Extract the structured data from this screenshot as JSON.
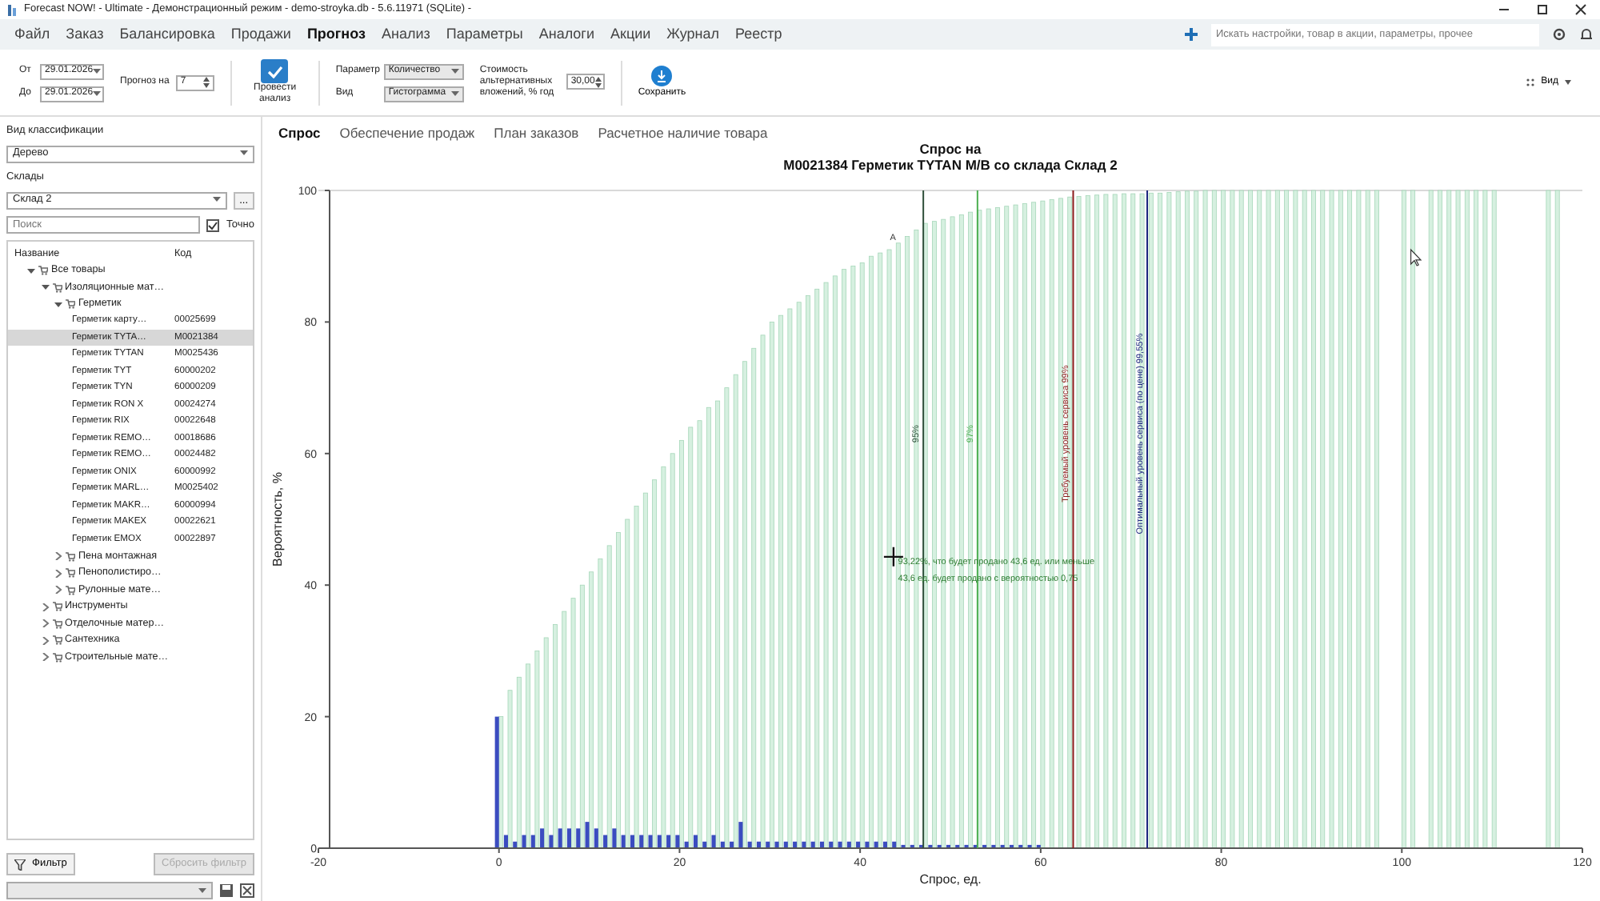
{
  "window": {
    "title": "Forecast NOW! - Ultimate - Демонстрационный режим - demo-stroyka.db - 5.6.11971 (SQLite) -"
  },
  "menu": [
    {
      "label": "Файл",
      "selected": false
    },
    {
      "label": "Заказ",
      "selected": false
    },
    {
      "label": "Балансировка",
      "selected": false
    },
    {
      "label": "Продажи",
      "selected": false
    },
    {
      "label": "Прогноз",
      "selected": true
    },
    {
      "label": "Анализ",
      "selected": false
    },
    {
      "label": "Параметры",
      "selected": false
    },
    {
      "label": "Аналоги",
      "selected": false
    },
    {
      "label": "Акции",
      "selected": false
    },
    {
      "label": "Журнал",
      "selected": false
    },
    {
      "label": "Реестр",
      "selected": false
    }
  ],
  "global_search": {
    "placeholder": "Искать настройки, товар в акции, параметры, прочее"
  },
  "toolbar": {
    "from_label": "От",
    "from_value": "29.01.2026",
    "to_label": "До",
    "to_value": "29.01.2026",
    "forecast_label": "Прогноз на",
    "forecast_value": "7",
    "analyze": {
      "label": "Провести анализ",
      "checked": true
    },
    "param_label": "Параметр",
    "param_value": "Количество",
    "view_label": "Вид",
    "view_value": "Гистограмма",
    "rate_label": "Стоимость альтернативных вложений, % год",
    "rate_value": "30,00",
    "save_label": "Сохранить",
    "view_menu": "Вид"
  },
  "sidebar": {
    "classification_label": "Вид классификации",
    "classification_value": "Дерево",
    "warehouses_label": "Склады",
    "warehouse_value": "Склад 2",
    "browse_button": "...",
    "search": {
      "placeholder": "Поиск"
    },
    "exact": {
      "label": "Точно",
      "checked": true
    },
    "columns": [
      "Название",
      "Код"
    ],
    "tree": [
      {
        "name": "Все товары",
        "expanded": true,
        "selected": false,
        "children": [
          {
            "name": "Изоляционные мат…",
            "expanded": true,
            "selected": false,
            "children": [
              {
                "name": "Герметик",
                "expanded": true,
                "selected": false,
                "children": [
                  {
                    "name": "Герметик карту…",
                    "code": "00025699",
                    "selected": false
                  },
                  {
                    "name": "Герметик TYTA…",
                    "code": "M0021384",
                    "selected": true
                  },
                  {
                    "name": "Герметик TYTAN",
                    "code": "M0025436",
                    "selected": false
                  },
                  {
                    "name": "Герметик TYT",
                    "code": "60000202",
                    "selected": false
                  },
                  {
                    "name": "Герметик TYN",
                    "code": "60000209",
                    "selected": false
                  },
                  {
                    "name": "Герметик RON X",
                    "code": "00024274",
                    "selected": false
                  },
                  {
                    "name": "Герметик RIX",
                    "code": "00022648",
                    "selected": false
                  },
                  {
                    "name": "Герметик REMO…",
                    "code": "00018686",
                    "selected": false
                  },
                  {
                    "name": "Герметик REMO…",
                    "code": "00024482",
                    "selected": false
                  },
                  {
                    "name": "Герметик ONIX",
                    "code": "60000992",
                    "selected": false
                  },
                  {
                    "name": "Герметик MARL…",
                    "code": "M0025402",
                    "selected": false
                  },
                  {
                    "name": "Герметик MAKR…",
                    "code": "60000994",
                    "selected": false
                  },
                  {
                    "name": "Герметик MAKEX",
                    "code": "00022621",
                    "selected": false
                  },
                  {
                    "name": "Герметик EMOX",
                    "code": "00022897",
                    "selected": false
                  }
                ]
              },
              {
                "name": "Пена монтажная",
                "expanded": false,
                "selected": false
              },
              {
                "name": "Пенополистиро…",
                "expanded": false,
                "selected": false
              },
              {
                "name": "Рулонные мате…",
                "expanded": false,
                "selected": false
              }
            ]
          },
          {
            "name": "Инструменты",
            "expanded": false,
            "selected": false
          },
          {
            "name": "Отделочные матер…",
            "expanded": false,
            "selected": false
          },
          {
            "name": "Сантехника",
            "expanded": false,
            "selected": false
          },
          {
            "name": "Строительные мате…",
            "expanded": false,
            "selected": false
          }
        ]
      }
    ],
    "filter_button": "Фильтр",
    "reset_button": {
      "label": "Сбросить фильтр",
      "disabled": true
    }
  },
  "tabs": [
    {
      "label": "Спрос",
      "selected": true
    },
    {
      "label": "Обеспечение продаж",
      "selected": false
    },
    {
      "label": "План заказов",
      "selected": false
    },
    {
      "label": "Расчетное наличие товара",
      "selected": false
    }
  ],
  "chart_title_lines": [
    "Спрос на",
    "M0021384 Герметик TYTAN M/B со склада Склад 2"
  ],
  "chart_data": {
    "type": "bar",
    "xlabel": "Спрос, ед.",
    "ylabel": "Вероятность, %",
    "xlim": [
      -20,
      120
    ],
    "ylim": [
      0,
      100
    ],
    "xticks": [
      -20,
      0,
      20,
      40,
      60,
      80,
      100,
      120
    ],
    "yticks": [
      0,
      20,
      40,
      60,
      80,
      100
    ],
    "x": [
      0,
      1,
      2,
      3,
      4,
      5,
      6,
      7,
      8,
      9,
      10,
      11,
      12,
      13,
      14,
      15,
      16,
      17,
      18,
      19,
      20,
      21,
      22,
      23,
      24,
      25,
      26,
      27,
      28,
      29,
      30,
      31,
      32,
      33,
      34,
      35,
      36,
      37,
      38,
      39,
      40,
      41,
      42,
      43,
      44,
      45,
      46,
      47,
      48,
      49,
      50,
      51,
      52,
      53,
      54,
      55,
      56,
      57,
      58,
      59,
      60,
      61,
      62,
      63,
      64,
      65,
      66,
      67,
      68,
      69,
      70,
      71,
      72,
      73,
      74,
      75,
      76,
      77,
      78,
      79,
      80,
      81,
      82,
      83,
      84,
      85,
      86,
      87,
      88,
      89,
      90,
      91,
      92,
      93,
      94,
      95,
      96,
      97,
      98,
      99,
      100,
      101,
      102,
      103,
      104,
      105,
      106,
      107,
      108,
      109,
      110,
      111,
      112,
      113,
      114,
      115,
      116,
      117
    ],
    "series": [
      {
        "color": "#d6f0e0",
        "values": [
          20,
          24,
          26,
          28,
          30,
          32,
          34,
          36,
          38,
          40,
          42,
          44,
          46,
          48,
          50,
          52,
          54,
          56,
          58,
          60,
          62,
          64,
          65,
          67,
          68,
          70,
          72,
          74,
          76,
          78,
          80,
          81,
          82,
          83,
          84,
          85,
          86,
          87,
          88,
          88.5,
          89,
          90,
          90.5,
          91,
          92,
          93,
          94,
          95,
          95.3,
          95.6,
          96,
          96.3,
          96.7,
          97,
          97.2,
          97.4,
          97.6,
          97.8,
          98,
          98.2,
          98.4,
          98.6,
          98.8,
          99,
          99.1,
          99.2,
          99.3,
          99.4,
          99.4,
          99.5,
          99.5,
          99.5,
          99.6,
          99.6,
          99.7,
          99.8,
          99.9,
          99.9,
          100,
          100,
          100,
          100,
          100,
          100,
          100,
          100,
          100,
          100,
          100,
          100,
          100,
          100,
          100,
          100,
          100,
          100,
          100,
          100,
          null,
          null,
          100,
          100,
          null,
          100,
          100,
          100,
          100,
          100,
          100,
          100,
          100,
          null,
          null,
          null,
          null,
          null,
          100,
          100
        ]
      },
      {
        "color": "#3b4cc0",
        "values": [
          20,
          2,
          1,
          2,
          2,
          3,
          2,
          3,
          3,
          3,
          4,
          3,
          2,
          3,
          2,
          2,
          2,
          2,
          2,
          2,
          2,
          1,
          2,
          1,
          2,
          1,
          1,
          4,
          1,
          1,
          1,
          1,
          1,
          1,
          1,
          1,
          1,
          1,
          1,
          1,
          1,
          1,
          1,
          1,
          1,
          0.5,
          0.5,
          0.5,
          0.5,
          0.5,
          0.5,
          0.5,
          0.5,
          0.5,
          0.5,
          0.5,
          0.5,
          0.5,
          0.5,
          0.5,
          0.5,
          0,
          0,
          0,
          0,
          0,
          0,
          0,
          0,
          0,
          0,
          0,
          0,
          0,
          0,
          0,
          0,
          0,
          0,
          0,
          0,
          0,
          0,
          0,
          0,
          0,
          0,
          0,
          0,
          0,
          0,
          0,
          0,
          0,
          0,
          0,
          0,
          0,
          null,
          null,
          0,
          0,
          null,
          0,
          0,
          0,
          0,
          0,
          0,
          0,
          0,
          null,
          null,
          null,
          null,
          null,
          0,
          0
        ]
      }
    ],
    "ref_lines": [
      {
        "axis": "x",
        "value": 47,
        "color": "#2f4f3a"
      },
      {
        "axis": "x",
        "value": 53,
        "color": "#4caf50"
      },
      {
        "axis": "x",
        "value": 63.6,
        "color": "#8b1a1a"
      },
      {
        "axis": "x",
        "value": 71.8,
        "color": "#1a237e"
      }
    ],
    "annotations": [
      "95%",
      "97%",
      "Требуемый уровень сервиса 99%",
      "Оптимальный уровень сервиса (по цене) 99,55%",
      "93,22%, что будет продано 43,6 ед. или меньше",
      "43,6 ед. будет продано с вероятностью 0,75",
      "A"
    ]
  }
}
